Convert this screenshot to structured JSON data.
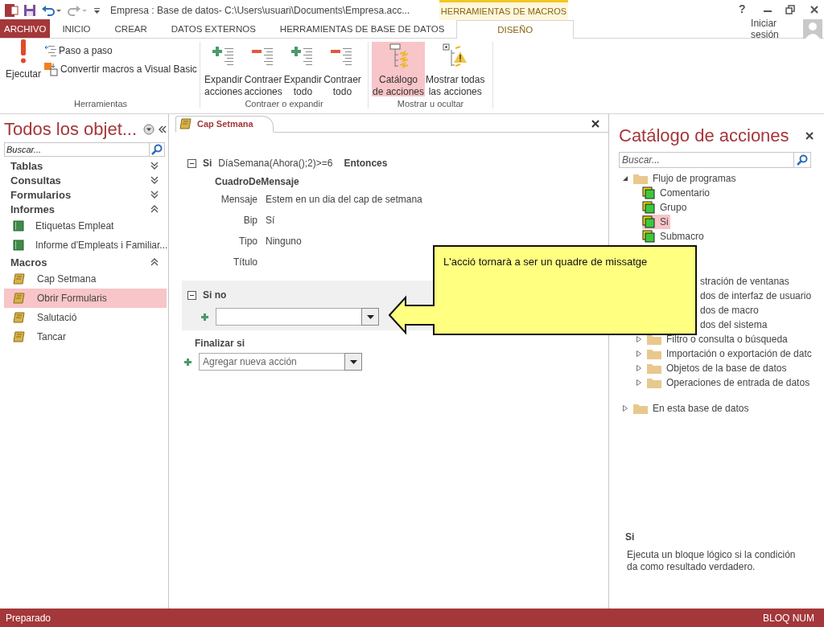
{
  "title_bar": {
    "title": "Empresa : Base de datos- C:\\Users\\usuari\\Documents\\Empresa.acc...",
    "context_tab": "HERRAMIENTAS DE MACROS",
    "help": "?"
  },
  "ribbon_tabs": [
    {
      "label": "ARCHIVO",
      "kind": "file",
      "selected": false
    },
    {
      "label": "INICIO",
      "kind": "normal",
      "selected": false
    },
    {
      "label": "CREAR",
      "kind": "normal",
      "selected": false
    },
    {
      "label": "DATOS EXTERNOS",
      "kind": "normal",
      "selected": false
    },
    {
      "label": "HERRAMIENTAS DE BASE DE DATOS",
      "kind": "normal",
      "selected": false
    },
    {
      "label": "DISEÑO",
      "kind": "context",
      "selected": true
    }
  ],
  "sign_in": "Iniciar sesión",
  "ribbon_groups": [
    {
      "label": "Herramientas",
      "buttons": [
        {
          "label": "Ejecutar",
          "kind": "run",
          "selected": false
        },
        {
          "label": "Paso a paso",
          "kind": "step",
          "selected": false
        },
        {
          "label": "Convertir macros a Visual Basic",
          "kind": "convert",
          "selected": false
        }
      ]
    },
    {
      "label": "Contraer o expandir",
      "buttons": [
        {
          "label": "Expandir\nacciones",
          "kind": "expand",
          "selected": false
        },
        {
          "label": "Contraer\nacciones",
          "kind": "collapse",
          "selected": false
        },
        {
          "label": "Expandir\ntodo",
          "kind": "expand",
          "selected": false
        },
        {
          "label": "Contraer\ntodo",
          "kind": "collapse",
          "selected": false
        }
      ]
    },
    {
      "label": "Mostrar u ocultar",
      "buttons": [
        {
          "label": "Catálogo\nde acciones",
          "kind": "catalog",
          "selected": true
        },
        {
          "label": "Mostrar todas\nlas acciones",
          "kind": "showall",
          "selected": false
        }
      ]
    }
  ],
  "navigation_pane": {
    "title": "Todos los objet...",
    "search": {
      "placeholder": "Buscar..."
    },
    "groups": [
      {
        "label": "Tablas",
        "expanded": false
      },
      {
        "label": "Consultas",
        "expanded": false
      },
      {
        "label": "Formularios",
        "expanded": false
      },
      {
        "label": "Informes",
        "expanded": true,
        "items": [
          {
            "label": "Etiquetas Empleat",
            "kind": "report",
            "selected": false
          },
          {
            "label": "Informe d'Empleats i Familiar...",
            "kind": "report",
            "selected": false
          }
        ]
      },
      {
        "label": "Macros",
        "expanded": true,
        "items": [
          {
            "label": "Cap Setmana",
            "kind": "macro",
            "selected": false
          },
          {
            "label": "Obrir Formularis",
            "kind": "macro",
            "selected": true
          },
          {
            "label": "Salutació",
            "kind": "macro",
            "selected": false
          },
          {
            "label": "Tancar",
            "kind": "macro",
            "selected": false
          }
        ]
      }
    ]
  },
  "editor": {
    "tab": "Cap Setmana",
    "if_block": {
      "keyword": "Si",
      "condition": "DíaSemana(Ahora();2)>=6",
      "then": "Entonces",
      "expanded": true,
      "action": {
        "name": "CuadroDeMensaje",
        "arguments": [
          {
            "name": "Mensaje",
            "value": "Estem en un dia del cap de setmana"
          },
          {
            "name": "Bip",
            "value": "Sí"
          },
          {
            "name": "Tipo",
            "value": "Ninguno"
          },
          {
            "name": "Título"
          }
        ]
      }
    },
    "else_block": {
      "keyword": "Si no",
      "expanded": true
    },
    "end_if": "Finalizar si",
    "new_action": {
      "placeholder": "Agregar nueva acción"
    }
  },
  "callout": {
    "text": "L'acció tornarà a ser un quadre de missatge"
  },
  "action_catalog": {
    "title": "Catálogo de acciones",
    "search": {
      "placeholder": "Buscar..."
    },
    "tree": [
      {
        "label": "Flujo de programas",
        "kind": "folder",
        "expanded": true,
        "children": [
          {
            "label": "Comentario",
            "kind": "action",
            "selected": false
          },
          {
            "label": "Grupo",
            "kind": "action",
            "selected": false
          },
          {
            "label": "Si",
            "kind": "action",
            "selected": true
          },
          {
            "label": "Submacro",
            "kind": "action",
            "selected": false
          }
        ]
      },
      {
        "kind": "covered",
        "children": [
          {
            "label": "stración de ventanas",
            "kind": "clipped"
          },
          {
            "label": "dos de interfaz de usuario",
            "kind": "clipped"
          },
          {
            "label": "dos de macro",
            "kind": "clipped"
          },
          {
            "label": "dos del sistema",
            "kind": "clipped"
          },
          {
            "label": "Filtro o consulta o búsqueda",
            "kind": "folder",
            "expanded": false
          },
          {
            "label": "Importación o exportación de datc",
            "kind": "folder",
            "expanded": false
          },
          {
            "label": "Objetos de la base de datos",
            "kind": "folder",
            "expanded": false
          },
          {
            "label": "Operaciones de entrada de datos",
            "kind": "folder",
            "expanded": false
          }
        ]
      },
      {
        "label": "En esta base de datos",
        "kind": "folder",
        "expanded": false
      }
    ],
    "help": {
      "title": "Si",
      "description": "Ejecuta un bloque lógico si la condición da como resultado verdadero."
    }
  },
  "status_bar": {
    "left": "Preparado",
    "right": "BLOQ NUM"
  }
}
